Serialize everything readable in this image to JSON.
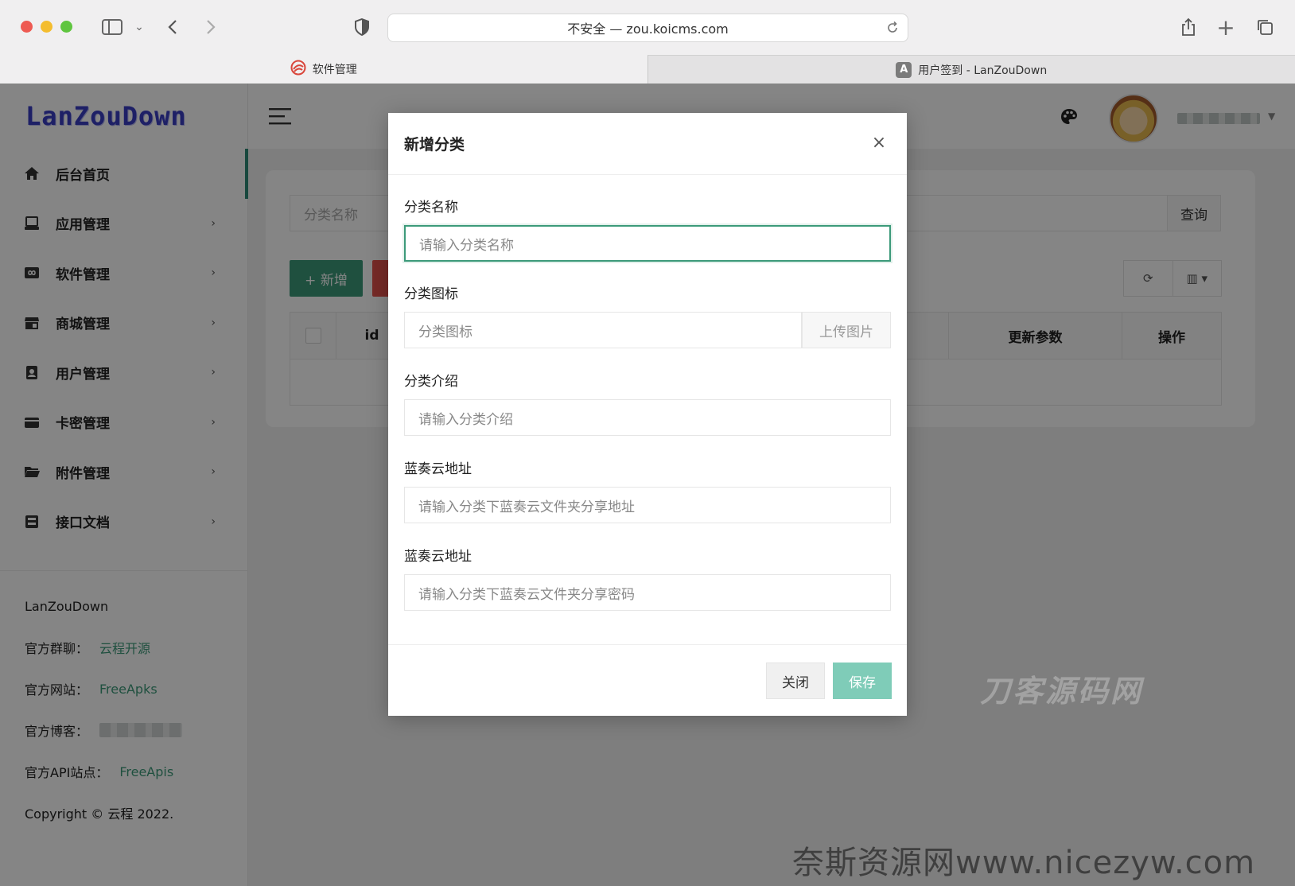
{
  "browser": {
    "url": "不安全 — zou.koicms.com",
    "tabs": [
      {
        "label": "软件管理",
        "active": true
      },
      {
        "label": "用户签到 - LanZouDown",
        "active": false,
        "icon_letter": "A"
      }
    ]
  },
  "sidebar": {
    "logo": "LanZouDown",
    "items": [
      {
        "label": "后台首页",
        "icon": "home-icon"
      },
      {
        "label": "应用管理",
        "icon": "app-icon"
      },
      {
        "label": "软件管理",
        "icon": "infinity-icon"
      },
      {
        "label": "商城管理",
        "icon": "store-icon"
      },
      {
        "label": "用户管理",
        "icon": "user-badge-icon"
      },
      {
        "label": "卡密管理",
        "icon": "card-icon"
      },
      {
        "label": "附件管理",
        "icon": "folder-icon"
      },
      {
        "label": "接口文档",
        "icon": "inbox-icon"
      }
    ],
    "chevron": "›",
    "footer": {
      "brand": "LanZouDown",
      "rows": [
        {
          "label": "官方群聊：",
          "link": "云程开源"
        },
        {
          "label": "官方网站：",
          "link": "FreeApks"
        },
        {
          "label": "官方博客：",
          "link": ""
        },
        {
          "label": "官方API站点：",
          "link": "FreeApis"
        }
      ],
      "copyright": "Copyright © 云程 2022."
    }
  },
  "content": {
    "search_placeholder": "分类名称",
    "query_label": "查询",
    "add_label": "+ 新增",
    "table_headers": [
      "id",
      "更新参数",
      "操作"
    ]
  },
  "modal": {
    "title": "新增分类",
    "close_glyph": "×",
    "fields": [
      {
        "label": "分类名称",
        "placeholder": "请输入分类名称"
      },
      {
        "label": "分类图标",
        "placeholder": "分类图标",
        "button": "上传图片"
      },
      {
        "label": "分类介绍",
        "placeholder": "请输入分类介绍"
      },
      {
        "label": "蓝奏云地址",
        "placeholder": "请输入分类下蓝奏云文件夹分享地址"
      },
      {
        "label": "蓝奏云地址",
        "placeholder": "请输入分类下蓝奏云文件夹分享密码"
      }
    ],
    "close_label": "关闭",
    "save_label": "保存"
  },
  "watermarks": {
    "middle": "刀客源码网",
    "bottom": "奈斯资源网www.nicezyw.com"
  },
  "colors": {
    "accent": "#3c9a7a",
    "save_button": "#7fccb8",
    "danger": "#e2524c",
    "logo": "#3a3fc4"
  }
}
